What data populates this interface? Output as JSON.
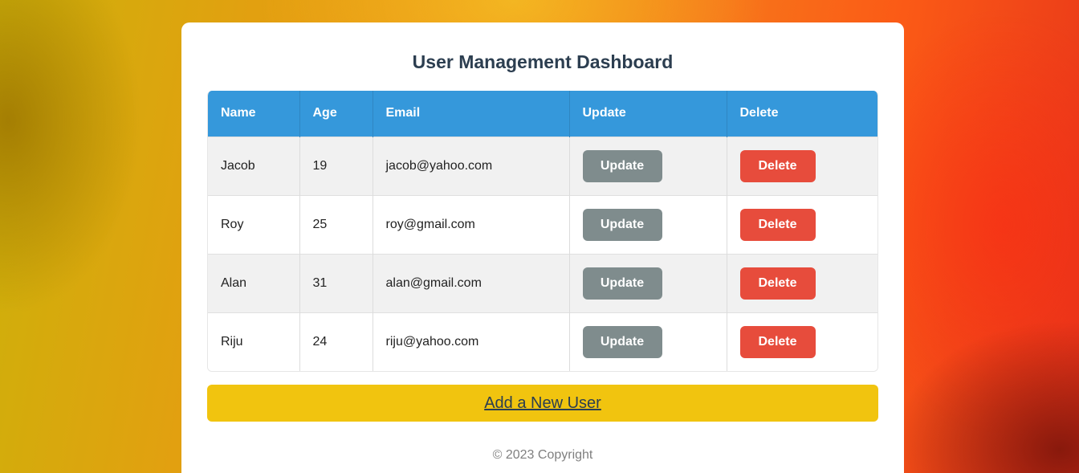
{
  "page": {
    "title": "User Management Dashboard",
    "add_user_label": "Add a New User",
    "footer": "© 2023 Copyright"
  },
  "colors": {
    "header": "#3598db",
    "update_button": "#7f8c8d",
    "delete_button": "#e74c3c",
    "add_button": "#f1c40f",
    "title": "#2c3e50"
  },
  "table": {
    "columns": [
      "Name",
      "Age",
      "Email",
      "Update",
      "Delete"
    ],
    "rows": [
      {
        "name": "Jacob",
        "age": "19",
        "email": "jacob@yahoo.com",
        "update": "Update",
        "delete": "Delete"
      },
      {
        "name": "Roy",
        "age": "25",
        "email": "roy@gmail.com",
        "update": "Update",
        "delete": "Delete"
      },
      {
        "name": "Alan",
        "age": "31",
        "email": "alan@gmail.com",
        "update": "Update",
        "delete": "Delete"
      },
      {
        "name": "Riju",
        "age": "24",
        "email": "riju@yahoo.com",
        "update": "Update",
        "delete": "Delete"
      }
    ]
  }
}
